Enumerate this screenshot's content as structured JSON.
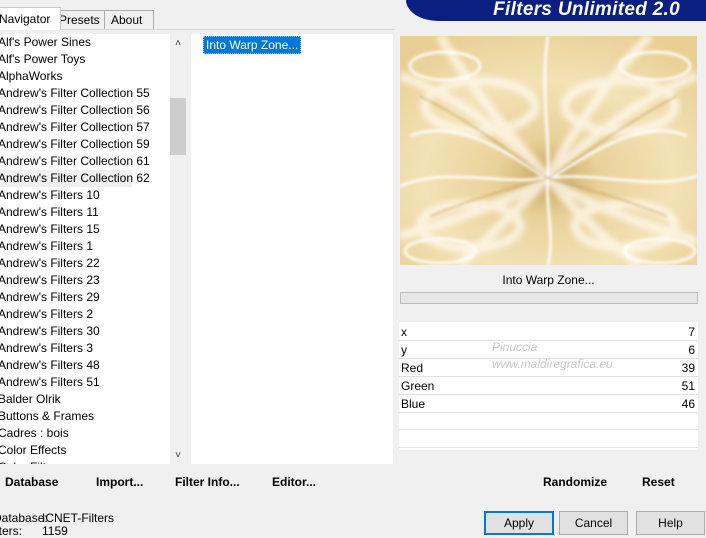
{
  "tabs": [
    "Navigator",
    "Presets",
    "About"
  ],
  "banner_title": "Filters Unlimited 2.0",
  "categories": [
    "Alf's Power Sines",
    "Alf's Power Toys",
    "AlphaWorks",
    "Andrew's Filter Collection 55",
    "Andrew's Filter Collection 56",
    "Andrew's Filter Collection 57",
    "Andrew's Filter Collection 59",
    "Andrew's Filter Collection 61",
    "Andrew's Filter Collection 62",
    "Andrew's Filters 10",
    "Andrew's Filters 11",
    "Andrew's Filters 15",
    "Andrew's Filters 1",
    "Andrew's Filters 22",
    "Andrew's Filters 23",
    "Andrew's Filters 29",
    "Andrew's Filters 2",
    "Andrew's Filters 30",
    "Andrew's Filters 3",
    "Andrew's Filters 48",
    "Andrew's Filters 51",
    "Balder Olrik",
    "Buttons & Frames",
    "Cadres : bois",
    "Color Effects",
    "Color Filters"
  ],
  "selected_category_index": 8,
  "filters": [
    "Into Warp Zone..."
  ],
  "selected_filter_name": "Into Warp Zone...",
  "parameters": [
    {
      "label": "x",
      "value": "7"
    },
    {
      "label": "y",
      "value": "6"
    },
    {
      "label": "Red",
      "value": "39"
    },
    {
      "label": "Green",
      "value": "51"
    },
    {
      "label": "Blue",
      "value": "46"
    }
  ],
  "watermark": {
    "line1": "Pinuccia",
    "line2": "www.maldiregrafica.eu"
  },
  "toolbar_left": {
    "database": "Database",
    "import": "Import...",
    "filter_info": "Filter Info...",
    "editor": "Editor..."
  },
  "toolbar_right": {
    "randomize": "Randomize",
    "reset": "Reset"
  },
  "status": {
    "db_label": "Database:",
    "db_value": "ICNET-Filters",
    "filters_label": "Filters:",
    "filters_value": "1159"
  },
  "buttons": {
    "apply": "Apply",
    "cancel": "Cancel",
    "help": "Help"
  },
  "colors": {
    "banner": "#0a1f80",
    "selection": "#0078d7",
    "preview_base": "#efdaa3"
  }
}
